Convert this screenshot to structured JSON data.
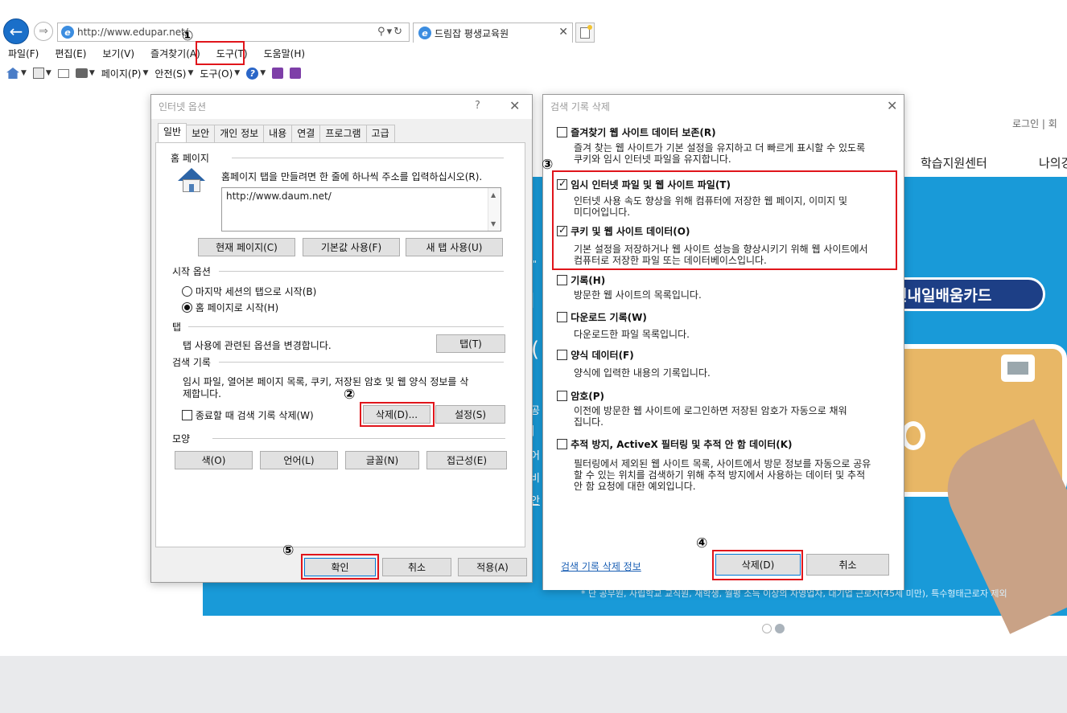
{
  "browser": {
    "url": "http://www.edupar.net/",
    "tab_title": "드림잡 평생교육원",
    "menu": [
      "파일(F)",
      "편집(E)",
      "보기(V)",
      "즐겨찾기(A)",
      "도구(T)",
      "도움말(H)"
    ],
    "commands": {
      "page": "페이지(P)",
      "safety": "안전(S)",
      "tools": "도구(O)"
    }
  },
  "steps": [
    "①",
    "②",
    "③",
    "④",
    "⑤"
  ],
  "webpage": {
    "login": "로그인 |  회",
    "nav_1": "학습지원센터",
    "nav_2": "나의강",
    "card_label": "민내일배움카드",
    "footer_note": "* 단 공무원, 사립학교 교직원, 재학생, 월평 소득 이상의 자영업자, 대기업 근로자(45세 미만), 특수형태근로자 제외",
    "side_text": [
      "\"",
      "I",
      "(",
      "공",
      "|",
      "어",
      "비",
      "안"
    ]
  },
  "internet_options": {
    "title": "인터넷 옵션",
    "help": "?",
    "close": "✕",
    "tabs": [
      "일반",
      "보안",
      "개인 정보",
      "내용",
      "연결",
      "프로그램",
      "고급"
    ],
    "home_group": "홈 페이지",
    "home_desc": "홈페이지 탭을 만들려면 한 줄에 하나씩 주소를 입력하십시오(R).",
    "home_url": "http://www.daum.net/",
    "btn_current": "현재 페이지(C)",
    "btn_default": "기본값 사용(F)",
    "btn_newtab": "새 탭 사용(U)",
    "start_group": "시작 옵션",
    "radio_last": "마지막 세션의 탭으로 시작(B)",
    "radio_home": "홈 페이지로 시작(H)",
    "tab_group": "탭",
    "tab_desc": "탭 사용에 관련된 옵션을 변경합니다.",
    "btn_tabs": "탭(T)",
    "history_group": "검색 기록",
    "history_desc_1": "임시 파일, 열어본 페이지 목록, 쿠키, 저장된 암호 및 웹 양식 정보를 삭",
    "history_desc_2": "제합니다.",
    "chk_on_exit": "종료할 때 검색 기록 삭제(W)",
    "btn_delete": "삭제(D)...",
    "btn_settings": "설정(S)",
    "look_group": "모양",
    "btn_color": "색(O)",
    "btn_language": "언어(L)",
    "btn_fonts": "글꼴(N)",
    "btn_access": "접근성(E)",
    "btn_ok": "확인",
    "btn_cancel": "취소",
    "btn_apply": "적용(A)"
  },
  "delete_history": {
    "title": "검색 기록 삭제",
    "close": "✕",
    "options": [
      {
        "label": "즐겨찾기 웹 사이트 데이터 보존(R)",
        "checked": false,
        "desc": [
          "즐겨 찾는 웹 사이트가 기본 설정을 유지하고 더 빠르게 표시할 수 있도록",
          "쿠키와 임시 인터넷 파일을 유지합니다."
        ]
      },
      {
        "label": "임시 인터넷 파일 및 웹 사이트 파일(T)",
        "checked": true,
        "desc": [
          "인터넷 사용 속도 향상을 위해 컴퓨터에 저장한 웹 페이지, 이미지 및",
          "미디어입니다."
        ]
      },
      {
        "label": "쿠키 및 웹 사이트 데이터(O)",
        "checked": true,
        "desc": [
          "기본 설정을 저장하거나 웹 사이트 성능을 향상시키기 위해 웹 사이트에서",
          "컴퓨터로 저장한 파일 또는 데이터베이스입니다."
        ]
      },
      {
        "label": "기록(H)",
        "checked": false,
        "desc": [
          "방문한 웹 사이트의 목록입니다."
        ]
      },
      {
        "label": "다운로드 기록(W)",
        "checked": false,
        "desc": [
          "다운로드한 파일 목록입니다."
        ]
      },
      {
        "label": "양식 데이터(F)",
        "checked": false,
        "desc": [
          "양식에 입력한 내용의 기록입니다."
        ]
      },
      {
        "label": "암호(P)",
        "checked": false,
        "desc": [
          "이전에 방문한 웹 사이트에 로그인하면 저장된 암호가 자동으로 채워",
          "집니다."
        ]
      },
      {
        "label": "추적 방지, ActiveX 필터링 및 추적 안 함 데이터(K)",
        "checked": false,
        "desc": [
          "필터링에서 제외된 웹 사이트 목록, 사이트에서 방문 정보를 자동으로 공유",
          "할 수 있는 위치를 검색하기 위해 추적 방지에서 사용하는 데이터 및 추적",
          "안 함 요청에 대한 예외입니다."
        ]
      }
    ],
    "link": "검색 기록 삭제 정보",
    "btn_delete": "삭제(D)",
    "btn_cancel": "취소"
  },
  "colors": {
    "highlight": "#e0151b",
    "banner": "#199ad8",
    "pill": "#1d3f86",
    "ie_blue": "#1a6fc9"
  }
}
